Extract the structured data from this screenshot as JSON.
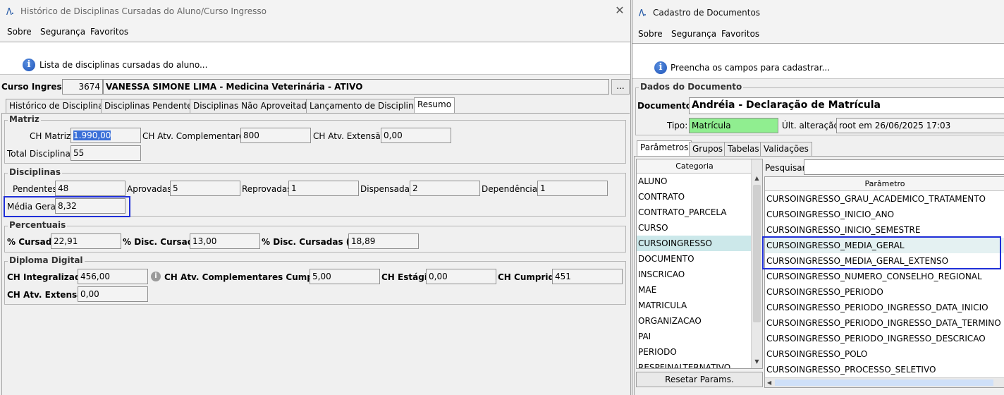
{
  "left": {
    "title": "Histórico de Disciplinas Cursadas do Aluno/Curso Ingresso",
    "menu": [
      "Sobre",
      "Segurança",
      "Favoritos"
    ],
    "info": "Lista de disciplinas cursadas do aluno...",
    "curso_label": "Curso Ingresso:",
    "curso_id": "3674",
    "curso_nome": "VANESSA SIMONE LIMA - Medicina Veterinária - ATIVO",
    "ellipsis": "...",
    "tabs": [
      "Histórico de Disciplinas",
      "Disciplinas Pendentes",
      "Disciplinas Não Aproveitadas",
      "Lançamento de Disciplinas",
      "Resumo"
    ],
    "matriz": {
      "title": "Matriz",
      "ch_matriz_label": "CH Matriz:",
      "ch_matriz": "1.990,00",
      "ch_atv_label": "CH Atv. Complementares:",
      "ch_atv": "800",
      "ch_ext_label": "CH Atv. Extensão:",
      "ch_ext": "0,00",
      "total_label": "Total Disciplinas:",
      "total": "55"
    },
    "disciplinas": {
      "title": "Disciplinas",
      "pendentes_label": "Pendentes:",
      "pendentes": "48",
      "aprovadas_label": "Aprovadas:",
      "aprovadas": "5",
      "reprovadas_label": "Reprovadas:",
      "reprovadas": "1",
      "dispensadas_label": "Dispensadas:",
      "dispensadas": "2",
      "dependencias_label": "Dependências:",
      "dependencias": "1",
      "media_label": "Média Geral:",
      "media": "8,32"
    },
    "percentuais": {
      "title": "Percentuais",
      "cursado_label": "% Cursado:",
      "cursado": "22,91",
      "disc_label": "% Disc. Cursadas:",
      "disc": "13,00",
      "disc_hr_label": "% Disc. Cursadas (HR):",
      "disc_hr": "18,89"
    },
    "diploma": {
      "title": "Diploma Digital",
      "integralizada_label": "CH Integralizada:",
      "integralizada": "456,00",
      "cumpridas_label": "CH Atv. Complementares Cumpridas:",
      "cumpridas": "5,00",
      "estagio_label": "CH Estágio:",
      "estagio": "0,00",
      "cumprida_label": "CH Cumprida:",
      "cumprida": "451",
      "extensao_label": "CH Atv. Extensão:",
      "extensao": "0,00"
    }
  },
  "right": {
    "title": "Cadastro de Documentos",
    "menu": [
      "Sobre",
      "Segurança",
      "Favoritos"
    ],
    "info": "Preencha os campos para cadastrar...",
    "dados_title": "Dados do Documento",
    "documento_label": "Documento:",
    "documento": "Andréia - Declaração de Matrícula",
    "tipo_label": "Tipo:",
    "tipo": "Matrícula",
    "ult_label": "Últ. alteração:",
    "ult": "root em 26/06/2025 17:03",
    "tabs": [
      "Parâmetros",
      "Grupos",
      "Tabelas",
      "Validações"
    ],
    "categoria_header": "Categoria",
    "categorias": [
      "ALUNO",
      "CONTRATO",
      "CONTRATO_PARCELA",
      "CURSO",
      "CURSOINGRESSO",
      "DOCUMENTO",
      "INSCRICAO",
      "MAE",
      "MATRICULA",
      "ORGANIZACAO",
      "PAI",
      "PERIODO",
      "RESPFINALTERNATIVO"
    ],
    "pesquisar_label": "Pesquisar:",
    "parametro_header": "Parâmetro",
    "parametros": [
      "CURSOINGRESSO_GRAU_ACADEMICO_TRATAMENTO",
      "CURSOINGRESSO_INICIO_ANO",
      "CURSOINGRESSO_INICIO_SEMESTRE",
      "CURSOINGRESSO_MEDIA_GERAL",
      "CURSOINGRESSO_MEDIA_GERAL_EXTENSO",
      "CURSOINGRESSO_NUMERO_CONSELHO_REGIONAL",
      "CURSOINGRESSO_PERIODO",
      "CURSOINGRESSO_PERIODO_INGRESSO_DATA_INICIO",
      "CURSOINGRESSO_PERIODO_INGRESSO_DATA_TERMINO",
      "CURSOINGRESSO_PERIODO_INGRESSO_DESCRICAO",
      "CURSOINGRESSO_POLO",
      "CURSOINGRESSO_PROCESSO_SELETIVO"
    ],
    "reset_label": "Resetar Params."
  },
  "colors": {
    "highlight": "#1f2fd8",
    "selection": "#cce8ea",
    "tipo_bg": "#90ee90",
    "info_icon": "#1d52b8"
  },
  "icons": [
    "app-logo-icon",
    "close-icon",
    "info-icon",
    "scroll-up-icon",
    "scroll-down-icon",
    "scroll-left-icon"
  ]
}
